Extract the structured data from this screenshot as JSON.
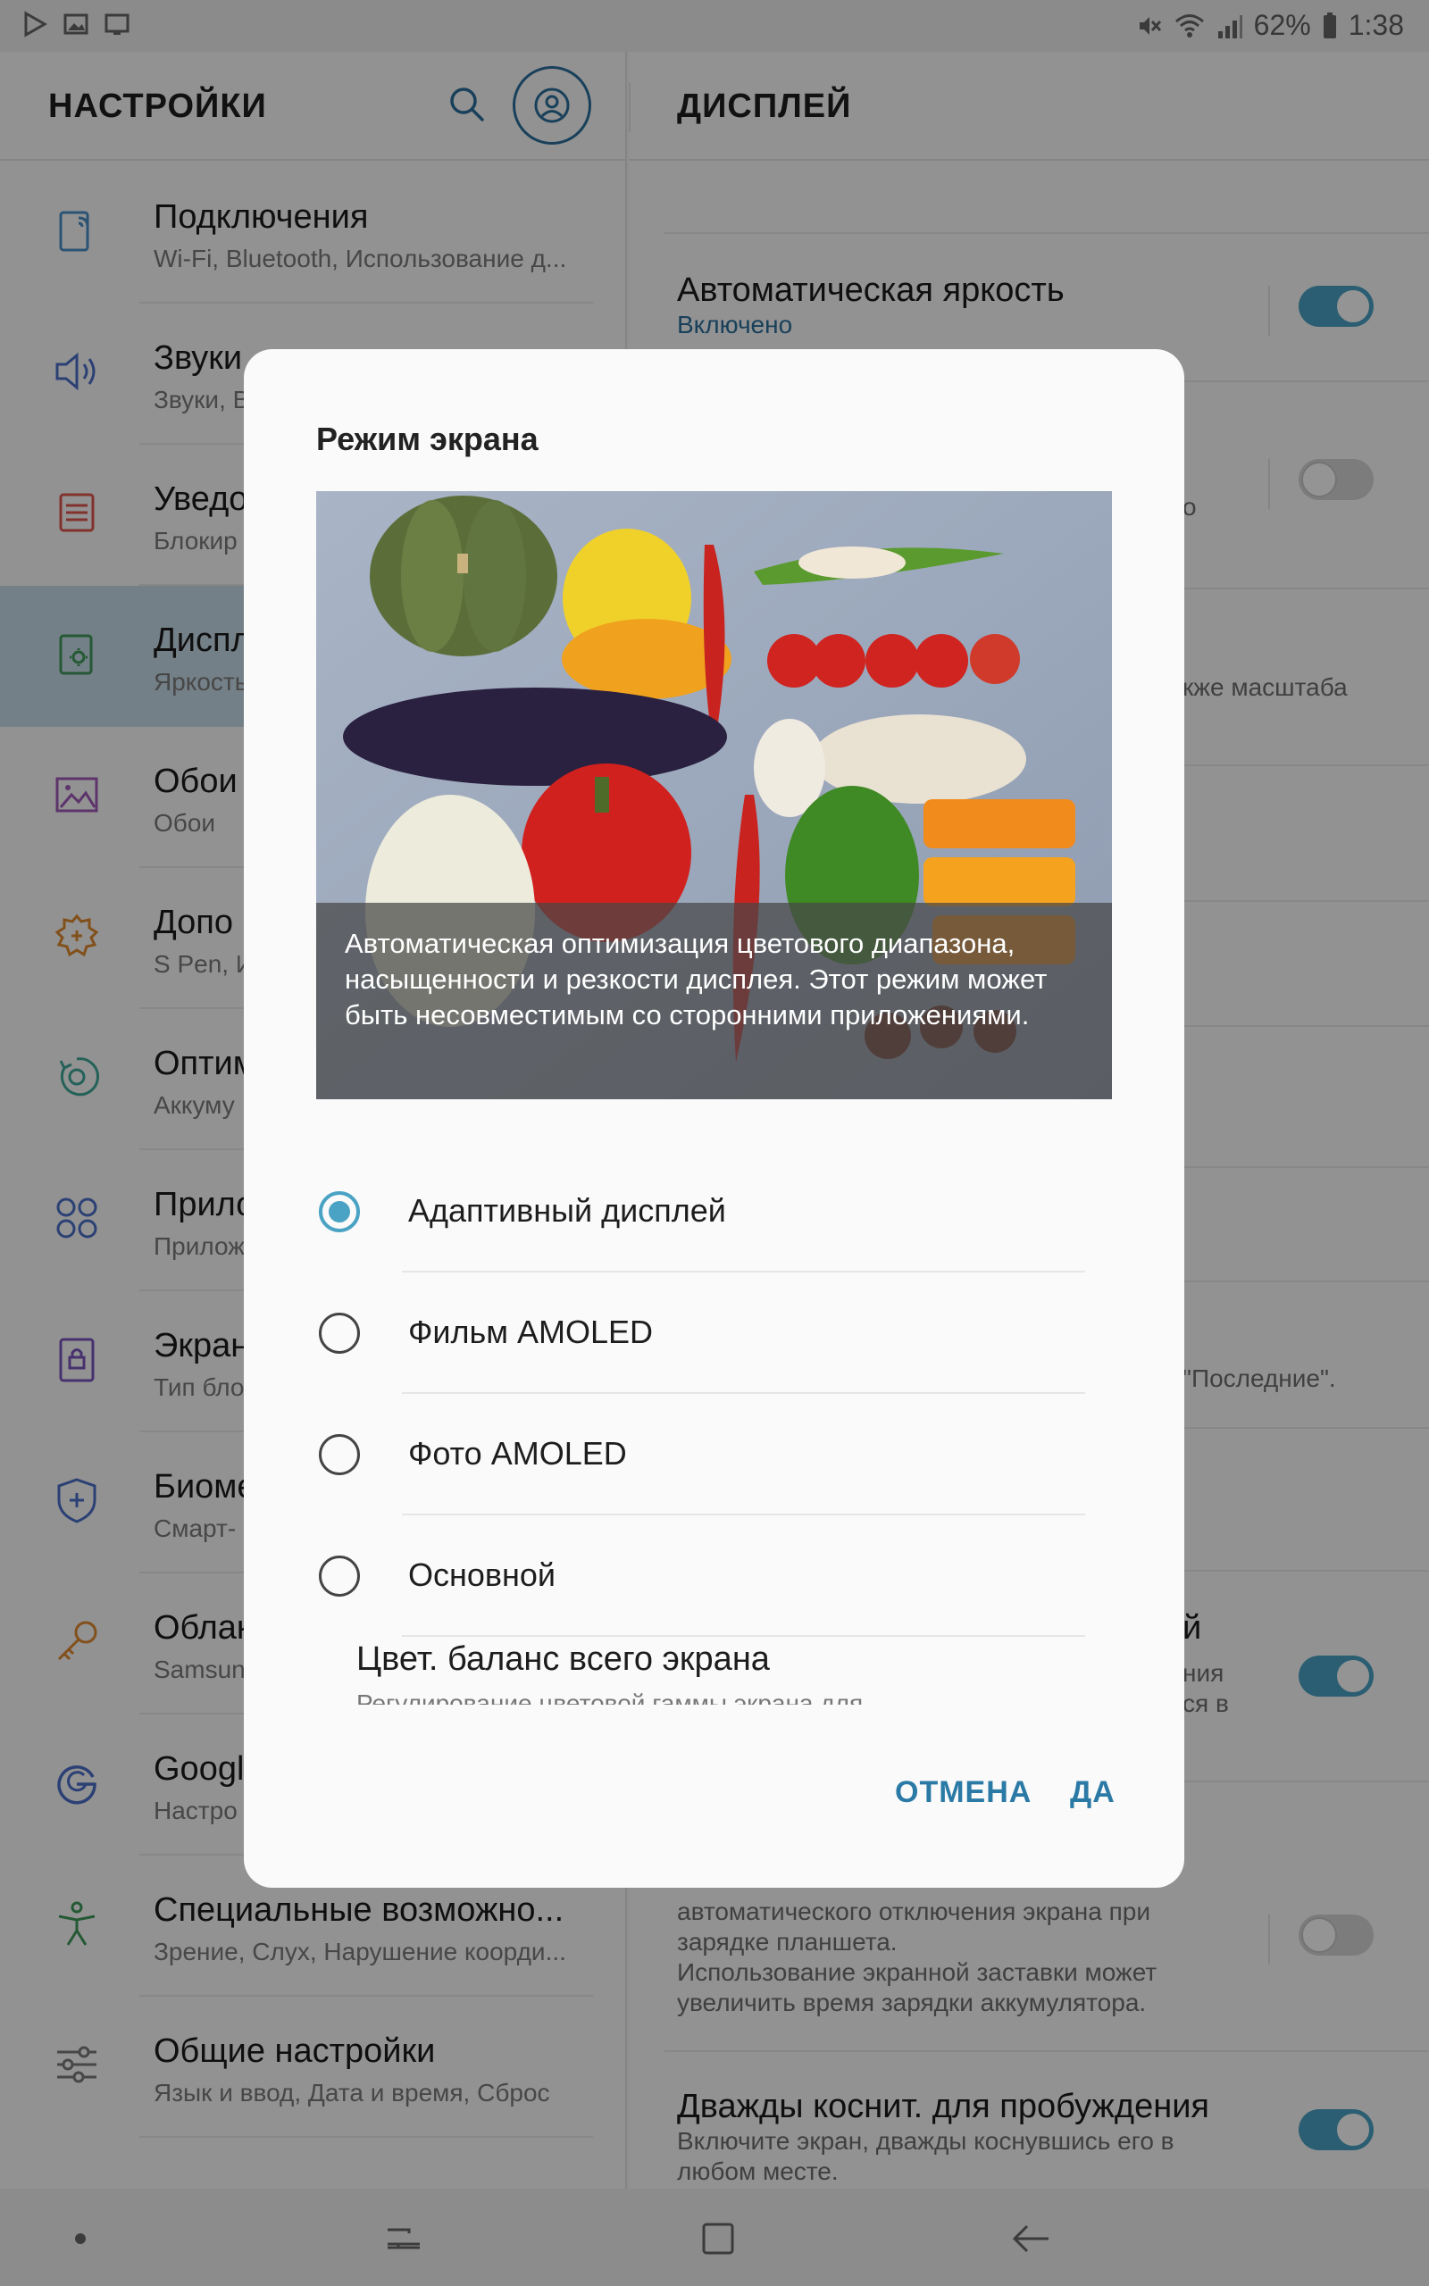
{
  "status_bar": {
    "battery": "62%",
    "time": "1:38"
  },
  "left_pane": {
    "title": "НАСТРОЙКИ",
    "items": [
      {
        "title": "Подключения",
        "subtitle": "Wi-Fi, Bluetooth, Использование д..."
      },
      {
        "title": "Звуки",
        "subtitle": "Звуки, В"
      },
      {
        "title": "Уведо",
        "subtitle": "Блокир"
      },
      {
        "title": "Диспл",
        "subtitle": "Яркость"
      },
      {
        "title": "Обои",
        "subtitle": "Обои"
      },
      {
        "title": "Допо",
        "subtitle": "S Pen, И"
      },
      {
        "title": "Оптим",
        "subtitle": "Аккуму"
      },
      {
        "title": "Прило",
        "subtitle": "Прилож"
      },
      {
        "title": "Экран",
        "subtitle": "Тип бло"
      },
      {
        "title": "Биоме",
        "subtitle": "Смарт-"
      },
      {
        "title": "Облак",
        "subtitle": "Samsun"
      },
      {
        "title": "Googl",
        "subtitle": "Настро"
      },
      {
        "title": "Специальные возможно...",
        "subtitle": "Зрение, Слух, Нарушение коорди..."
      },
      {
        "title": "Общие настройки",
        "subtitle": "Язык и ввод, Дата и время, Сброс"
      }
    ]
  },
  "right_pane": {
    "title": "ДИСПЛЕЙ",
    "auto_brightness": {
      "title": "Автоматическая яркость",
      "subtitle": "Включено"
    },
    "partial_1": "о",
    "partial_2": "кже масштаба",
    "partial_3": "\"Последние\".",
    "partial_4": "й",
    "partial_5": "ния",
    "partial_6": "ся в",
    "screensaver_sub": [
      "автоматического отключения экрана при",
      "зарядке планшета.",
      "Использование экранной заставки может",
      "увеличить время зарядки аккумулятора."
    ],
    "double_tap": {
      "title": "Дважды коснит. для пробуждения",
      "subtitle": [
        "Включите экран, дважды коснувшись его в",
        "любом месте."
      ]
    }
  },
  "dialog": {
    "title": "Режим экрана",
    "caption": "Автоматическая оптимизация цветового диапазона, насыщенности и резкости дисплея. Этот режим может быть несовместимым со сторонними приложениями.",
    "options": [
      {
        "label": "Адаптивный дисплей",
        "checked": true
      },
      {
        "label": "Фильм AMOLED",
        "checked": false
      },
      {
        "label": "Фото AMOLED",
        "checked": false
      },
      {
        "label": "Основной",
        "checked": false
      }
    ],
    "color_balance": {
      "title": "Цвет. баланс всего экрана",
      "subtitle": "Регулирование цветовой гаммы экрана для"
    },
    "cancel": "ОТМЕНА",
    "ok": "ДА"
  },
  "colors": {
    "accent": "#4aa3c4",
    "button": "#2b7aa6",
    "active_item": "#c9dde8"
  }
}
